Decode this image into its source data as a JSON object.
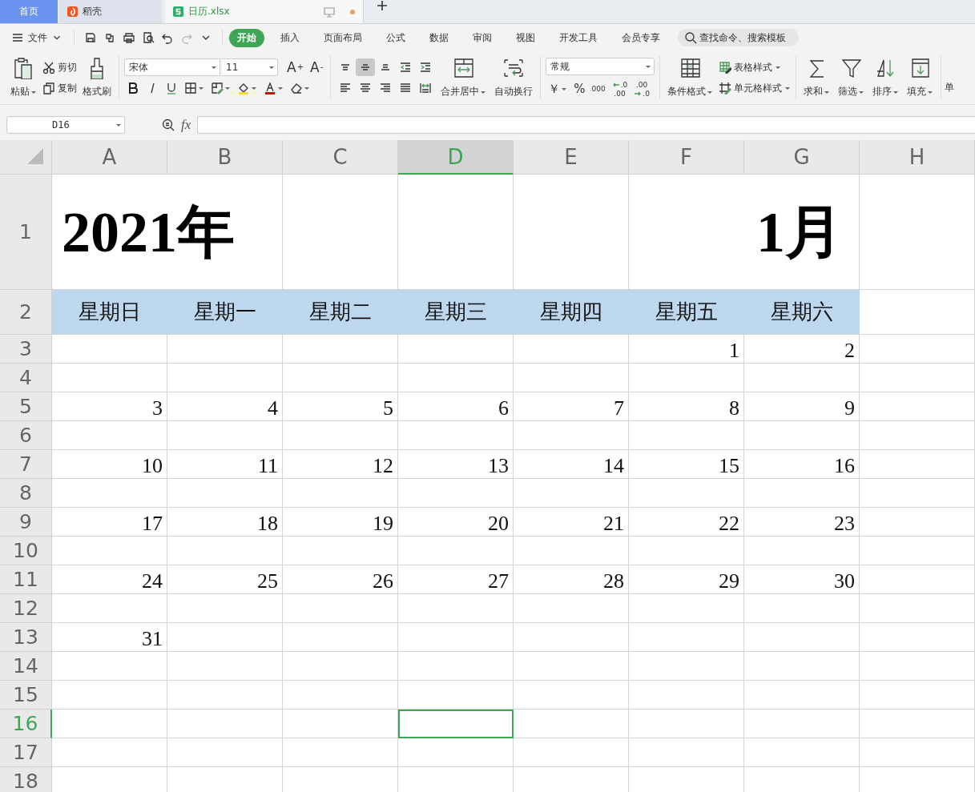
{
  "tabs": [
    {
      "kind": "home",
      "label": "首页",
      "selected": false
    },
    {
      "kind": "docer",
      "label": "稻壳",
      "selected": false
    },
    {
      "kind": "file",
      "label": "日历.xlsx",
      "selected": true,
      "unsaved": true
    }
  ],
  "menu": {
    "file_label": "文件",
    "ribbon_tabs": [
      {
        "label": "开始",
        "selected": true
      },
      {
        "label": "插入",
        "selected": false
      },
      {
        "label": "页面布局",
        "selected": false
      },
      {
        "label": "公式",
        "selected": false
      },
      {
        "label": "数据",
        "selected": false
      },
      {
        "label": "审阅",
        "selected": false
      },
      {
        "label": "视图",
        "selected": false
      },
      {
        "label": "开发工具",
        "selected": false
      },
      {
        "label": "会员专享",
        "selected": false
      }
    ],
    "search": {
      "placeholder": "查找命令、搜索模板"
    }
  },
  "clipboard": {
    "paste": "粘贴",
    "cut": "剪切",
    "copy": "复制",
    "format_painter": "格式刷"
  },
  "font": {
    "name": "宋体",
    "size": "11",
    "grow": {
      "letter": "A",
      "sign": "+"
    },
    "shrink": {
      "letter": "A",
      "sign": "-"
    }
  },
  "alignment": {
    "buttons": [
      {
        "selected": false
      },
      {
        "selected": true
      },
      {
        "selected": false
      },
      {
        "selected": false
      },
      {
        "selected": false
      },
      {
        "selected": false
      },
      {
        "selected": false
      },
      {
        "selected": false
      },
      {
        "selected": false
      },
      {
        "selected": false
      }
    ],
    "merge": "合并居中",
    "wrap": "自动换行"
  },
  "number": {
    "format": "常规",
    "currency": "￥",
    "percent": "%",
    "thousands": "000",
    "add_decimal": [
      ".0",
      ".00"
    ],
    "remove_decimal": [
      ".00",
      ".0"
    ]
  },
  "styles": {
    "conditional": "条件格式",
    "table_style": "表格样式",
    "cell_style": "单元格样式"
  },
  "editing": [
    {
      "kind": "large",
      "label": "求和"
    },
    {
      "kind": "large",
      "label": "筛选"
    },
    {
      "kind": "large",
      "label": "排序"
    },
    {
      "kind": "large",
      "label": "填充"
    },
    {
      "kind": "clipped",
      "label": "单"
    }
  ],
  "formula_bar": {
    "name_box": "D16",
    "fx": "fx"
  },
  "sheet": {
    "columns": [
      {
        "label": "A",
        "selected": false
      },
      {
        "label": "B",
        "selected": false
      },
      {
        "label": "C",
        "selected": false
      },
      {
        "label": "D",
        "selected": true
      },
      {
        "label": "E",
        "selected": false
      },
      {
        "label": "F",
        "selected": false
      },
      {
        "label": "G",
        "selected": false
      },
      {
        "label": "H",
        "selected": false
      }
    ],
    "rows": [
      {
        "label": "1",
        "kind": "title",
        "selected": false,
        "cells": [
          "2021年",
          null,
          null,
          null,
          null,
          null,
          "1月",
          null
        ]
      },
      {
        "label": "2",
        "kind": "weekday",
        "selected": false,
        "cells": [
          "星期日",
          "星期一",
          "星期二",
          "星期三",
          "星期四",
          "星期五",
          "星期六",
          null
        ]
      },
      {
        "label": "3",
        "kind": "date",
        "selected": false,
        "cells": [
          null,
          null,
          null,
          null,
          null,
          "1",
          "2",
          null
        ]
      },
      {
        "label": "4",
        "kind": "date",
        "selected": false,
        "cells": [
          null,
          null,
          null,
          null,
          null,
          null,
          null,
          null
        ]
      },
      {
        "label": "5",
        "kind": "date",
        "selected": false,
        "cells": [
          "3",
          "4",
          "5",
          "6",
          "7",
          "8",
          "9",
          null
        ]
      },
      {
        "label": "6",
        "kind": "date",
        "selected": false,
        "cells": [
          null,
          null,
          null,
          null,
          null,
          null,
          null,
          null
        ]
      },
      {
        "label": "7",
        "kind": "date",
        "selected": false,
        "cells": [
          "10",
          "11",
          "12",
          "13",
          "14",
          "15",
          "16",
          null
        ]
      },
      {
        "label": "8",
        "kind": "date",
        "selected": false,
        "cells": [
          null,
          null,
          null,
          null,
          null,
          null,
          null,
          null
        ]
      },
      {
        "label": "9",
        "kind": "date",
        "selected": false,
        "cells": [
          "17",
          "18",
          "19",
          "20",
          "21",
          "22",
          "23",
          null
        ]
      },
      {
        "label": "10",
        "kind": "date",
        "selected": false,
        "cells": [
          null,
          null,
          null,
          null,
          null,
          null,
          null,
          null
        ]
      },
      {
        "label": "11",
        "kind": "date",
        "selected": false,
        "cells": [
          "24",
          "25",
          "26",
          "27",
          "28",
          "29",
          "30",
          null
        ]
      },
      {
        "label": "12",
        "kind": "date",
        "selected": false,
        "cells": [
          null,
          null,
          null,
          null,
          null,
          null,
          null,
          null
        ]
      },
      {
        "label": "13",
        "kind": "date",
        "selected": false,
        "cells": [
          "31",
          null,
          null,
          null,
          null,
          null,
          null,
          null
        ]
      },
      {
        "label": "14",
        "kind": "date",
        "selected": false,
        "cells": [
          null,
          null,
          null,
          null,
          null,
          null,
          null,
          null
        ]
      },
      {
        "label": "15",
        "kind": "date",
        "selected": false,
        "cells": [
          null,
          null,
          null,
          null,
          null,
          null,
          null,
          null
        ]
      },
      {
        "label": "16",
        "kind": "date",
        "selected": true,
        "cells": [
          null,
          null,
          null,
          null,
          null,
          null,
          null,
          null
        ]
      },
      {
        "label": "17",
        "kind": "date",
        "selected": false,
        "cells": [
          null,
          null,
          null,
          null,
          null,
          null,
          null,
          null
        ]
      },
      {
        "label": "18",
        "kind": "date",
        "selected": false,
        "cells": [
          null,
          null,
          null,
          null,
          null,
          null,
          null,
          null
        ]
      }
    ]
  }
}
